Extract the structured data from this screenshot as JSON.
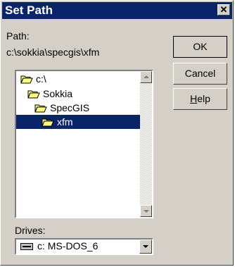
{
  "window": {
    "title": "Set Path",
    "close_glyph": "✕"
  },
  "path": {
    "label": "Path:",
    "value": "c:\\sokkia\\specgis\\xfm"
  },
  "buttons": {
    "ok": "OK",
    "cancel": "Cancel",
    "help_first": "H",
    "help_rest": "elp"
  },
  "directories": [
    {
      "name": "c:\\",
      "icon": "open-folder-icon"
    },
    {
      "name": "Sokkia",
      "icon": "open-folder-icon"
    },
    {
      "name": "SpecGIS",
      "icon": "open-folder-icon"
    },
    {
      "name": "xfm",
      "icon": "open-folder-icon",
      "selected": true
    }
  ],
  "drives": {
    "label": "Drives:",
    "selected": "c: MS-DOS_6",
    "icon": "hard-drive-icon"
  },
  "colors": {
    "title_bar": "#0a246a",
    "face": "#d4d0c8",
    "selection": "#0a246a"
  }
}
